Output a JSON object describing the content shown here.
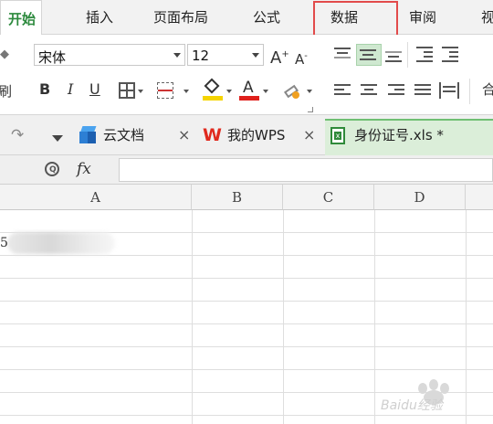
{
  "ribbon_tabs": [
    "开始",
    "插入",
    "页面布局",
    "公式",
    "数据",
    "审阅",
    "视"
  ],
  "font": {
    "name": "宋体",
    "size": "12"
  },
  "format_buttons": {
    "bold": "B",
    "italic": "I",
    "underline": "U",
    "grow": "A",
    "shrink": "A",
    "font_color": "A"
  },
  "left_edge_label": "刷",
  "doc_tabs": [
    {
      "label": "云文档",
      "icon": "cloud-cube-icon"
    },
    {
      "label": "我的WPS",
      "icon": "wps-logo-icon"
    },
    {
      "label": "身份证号.xls *",
      "icon": "spreadsheet-file-icon",
      "active": true
    }
  ],
  "formula_bar": {
    "fx_label": "fx",
    "value": ""
  },
  "columns": [
    "A",
    "B",
    "C",
    "D"
  ],
  "cell_a2_prefix": "5",
  "watermark_text": "Baidu经验",
  "colors": {
    "accent_green": "#2d8a3e",
    "highlight_red": "#e24b4b",
    "active_tab_bg": "#dbeed9"
  }
}
